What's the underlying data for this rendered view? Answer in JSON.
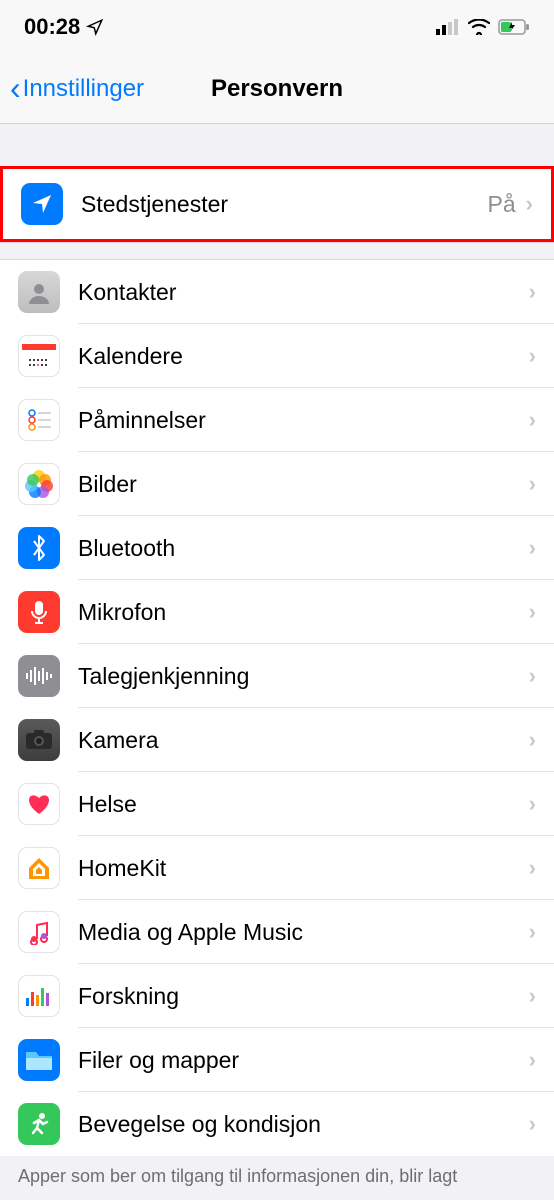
{
  "status": {
    "time": "00:28"
  },
  "nav": {
    "back": "Innstillinger",
    "title": "Personvern"
  },
  "sections": {
    "location": {
      "label": "Stedstjenester",
      "value": "På"
    },
    "items": [
      {
        "label": "Kontakter"
      },
      {
        "label": "Kalendere"
      },
      {
        "label": "Påminnelser"
      },
      {
        "label": "Bilder"
      },
      {
        "label": "Bluetooth"
      },
      {
        "label": "Mikrofon"
      },
      {
        "label": "Talegjenkjenning"
      },
      {
        "label": "Kamera"
      },
      {
        "label": "Helse"
      },
      {
        "label": "HomeKit"
      },
      {
        "label": "Media og Apple Music"
      },
      {
        "label": "Forskning"
      },
      {
        "label": "Filer og mapper"
      },
      {
        "label": "Bevegelse og kondisjon"
      }
    ]
  },
  "footer": "Apper som ber om tilgang til informasjonen din, blir lagt"
}
